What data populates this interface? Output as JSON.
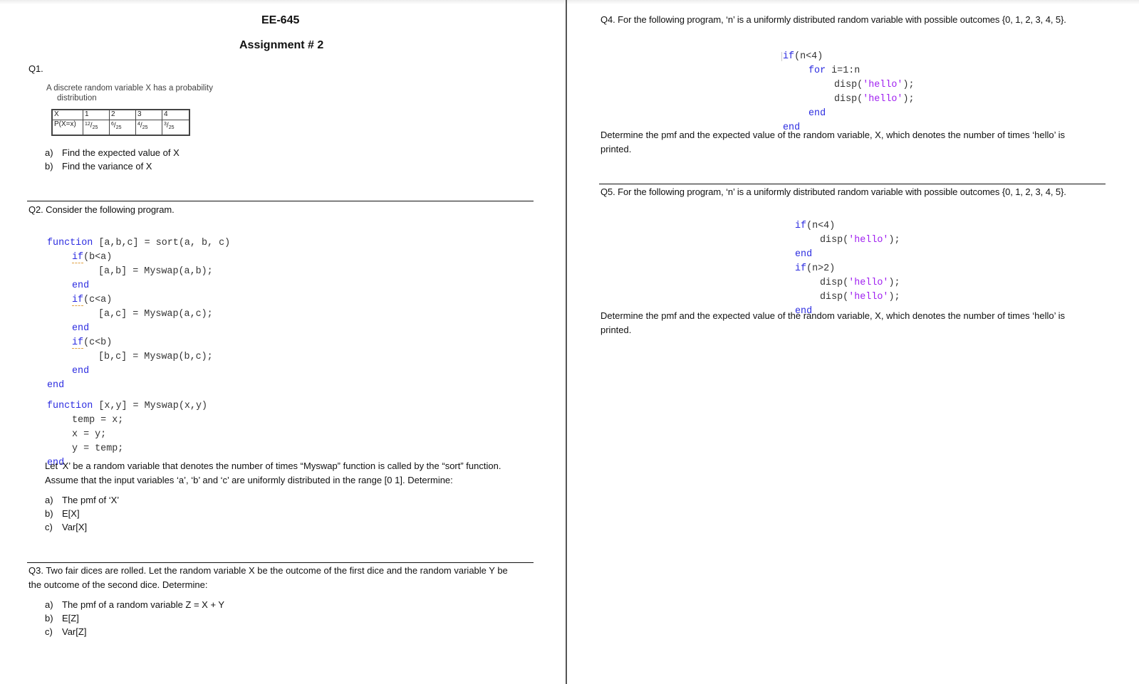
{
  "header": {
    "course": "EE-645",
    "assignment": "Assignment # 2"
  },
  "q1": {
    "label": "Q1.",
    "intro_line1": "A discrete random variable X has a probability",
    "intro_line2": "distribution",
    "table": {
      "row_x_label": "X",
      "x_values": [
        "1",
        "2",
        "3",
        "4"
      ],
      "row_p_label": "P(X=x)",
      "p_values": [
        {
          "num": "12",
          "den": "25"
        },
        {
          "num": "6",
          "den": "25"
        },
        {
          "num": "4",
          "den": "25"
        },
        {
          "num": "3",
          "den": "25"
        }
      ]
    },
    "parts": [
      {
        "marker": "a)",
        "text": "Find the expected value of X"
      },
      {
        "marker": "b)",
        "text": "Find the variance of X"
      }
    ]
  },
  "q2": {
    "heading": "Q2. Consider the following program.",
    "code": {
      "l1_kw": "function",
      "l1_rest": " [a,b,c] = sort(a, b, c)",
      "l2_kw": "if",
      "l2_rest": "(b<a)",
      "l3": "[a,b] = Myswap(a,b);",
      "l4_kw": "end",
      "l5_kw": "if",
      "l5_rest": "(c<a)",
      "l6": "[a,c] = Myswap(a,c);",
      "l7_kw": "end",
      "l8_kw": "if",
      "l8_rest": "(c<b)",
      "l9": "[b,c] = Myswap(b,c);",
      "l10_kw": "end",
      "l11_kw": "end",
      "l12_kw": "function",
      "l12_rest": " [x,y] = Myswap(x,y)",
      "l13": "temp = x;",
      "l14": "x = y;",
      "l15": "y = temp;",
      "l16_kw": "end"
    },
    "para_line1": "Let ‘X’ be a random variable that denotes the number of times “Myswap” function is called by the “sort” function.",
    "para_line2": "Assume that the input variables ‘a’, ‘b’ and ‘c’ are uniformly distributed in the range [0 1]. Determine:",
    "parts": [
      {
        "marker": "a)",
        "text": "The pmf of ‘X’"
      },
      {
        "marker": "b)",
        "text": "E[X]"
      },
      {
        "marker": "c)",
        "text": "Var[X]"
      }
    ]
  },
  "q3": {
    "para_line1": "Q3. Two fair dices are rolled. Let the random variable X be the outcome of the first dice and the random variable Y be",
    "para_line2": "the outcome of the second dice. Determine:",
    "parts": [
      {
        "marker": "a)",
        "text": "The pmf of a random variable Z = X + Y"
      },
      {
        "marker": "b)",
        "text": "E[Z]"
      },
      {
        "marker": "c)",
        "text": "Var[Z]"
      }
    ]
  },
  "q4": {
    "heading": "Q4. For the following program, ‘n’ is a uniformly distributed random variable with possible outcomes {0, 1, 2, 3, 4, 5}.",
    "code": {
      "l1_kw": "if",
      "l1_rest": "(n<4)",
      "l2_kw": "for",
      "l2_rest": " i=1:n",
      "l3_pre": "disp(",
      "l3_str": "'hello'",
      "l3_post": ");",
      "l4_pre": "disp(",
      "l4_str": "'hello'",
      "l4_post": ");",
      "l5_kw": "end",
      "l6_kw": "end"
    },
    "para_line1": "Determine the pmf and the expected value of the random variable, X, which denotes the number of times ‘hello’ is",
    "para_line2": "printed."
  },
  "q5": {
    "heading": "Q5. For the following program, ‘n’ is a uniformly distributed random variable with possible outcomes {0, 1, 2, 3, 4, 5}.",
    "code": {
      "l1_kw": "if",
      "l1_rest": "(n<4)",
      "l2_pre": "disp(",
      "l2_str": "'hello'",
      "l2_post": ");",
      "l3_kw": "end",
      "l4_kw": "if",
      "l4_rest": "(n>2)",
      "l5_pre": "disp(",
      "l5_str": "'hello'",
      "l5_post": ");",
      "l6_pre": "disp(",
      "l6_str": "'hello'",
      "l6_post": ");",
      "l7_kw": "end"
    },
    "para_line1": "Determine the pmf and the expected value of the random variable, X, which denotes the number of times ‘hello’ is",
    "para_line2": "printed."
  },
  "colors": {
    "keyword": "#2c2ce0",
    "string": "#a020f0",
    "divider": "#555555"
  }
}
